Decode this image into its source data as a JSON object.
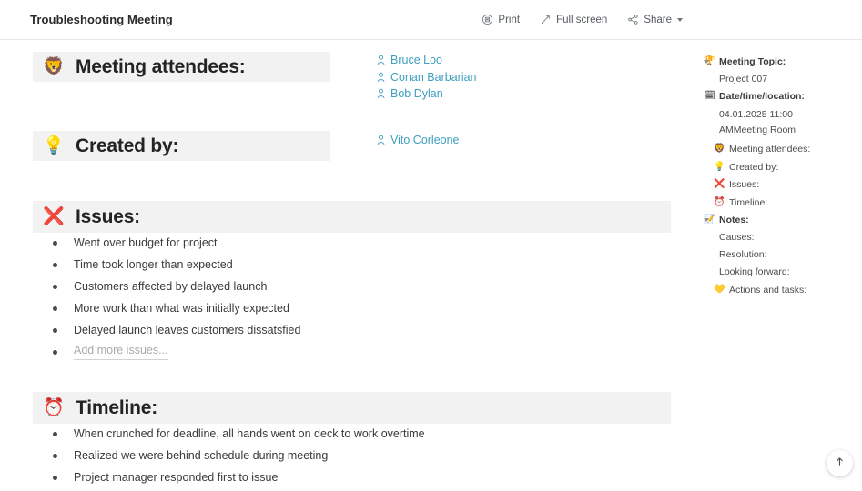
{
  "topbar": {
    "title": "Troubleshooting Meeting",
    "actions": [
      {
        "label": "Print",
        "icon": "print-icon"
      },
      {
        "label": "Full screen",
        "icon": "fullscreen-icon"
      },
      {
        "label": "Share",
        "icon": "share-icon",
        "caret": true
      }
    ]
  },
  "document": {
    "sections": [
      {
        "key": "attendees",
        "emoji": "🦁",
        "icon_name": "lion-face-emoji",
        "title": "Meeting attendees:",
        "people": [
          "Bruce Loo",
          "Conan Barbarian",
          "Bob Dylan"
        ]
      },
      {
        "key": "created_by",
        "emoji": "💡",
        "icon_name": "light-bulb-emoji",
        "title": "Created by:",
        "people": [
          "Vito Corleone"
        ]
      },
      {
        "key": "issues",
        "emoji": "❌",
        "icon_name": "cross-mark-emoji",
        "title": "Issues:",
        "items": [
          "Went over budget for project",
          "Time took longer than expected",
          "Customers affected by delayed launch",
          "More work than what was initially expected",
          "Delayed launch leaves customers dissatsfied"
        ],
        "placeholder": "Add more issues..."
      },
      {
        "key": "timeline",
        "emoji": "⏰",
        "icon_name": "alarm-clock-emoji",
        "title": "Timeline:",
        "items": [
          "When crunched for deadline, all hands went on deck to work overtime",
          "Realized we were behind schedule during meeting",
          "Project manager responded first to issue"
        ]
      }
    ]
  },
  "outline": {
    "rows": [
      {
        "label": "Meeting Topic:",
        "emoji": "🏆",
        "icon_name": "trophy-emoji",
        "twisty": true,
        "level": 0,
        "bold": true
      },
      {
        "label": "Project 007",
        "level": 1,
        "value": true
      },
      {
        "label": "Date/time/location:",
        "emoji": "🗓",
        "icon_name": "calendar-emoji",
        "twisty": true,
        "level": 0,
        "bold": true
      },
      {
        "label": "04.01.2025 11:00\nAMMeeting Room",
        "level": 1,
        "value": true,
        "multiline": true
      },
      {
        "label": "Meeting attendees:",
        "emoji": "🦁",
        "icon_name": "lion-face-emoji",
        "level": 0,
        "bold": true,
        "indent": true
      },
      {
        "label": "Created by:",
        "emoji": "💡",
        "icon_name": "light-bulb-emoji",
        "level": 0,
        "bold": true,
        "indent": true
      },
      {
        "label": "Issues:",
        "emoji": "❌",
        "icon_name": "cross-mark-emoji",
        "level": 0,
        "bold": true,
        "indent": true
      },
      {
        "label": "Timeline:",
        "emoji": "⏰",
        "icon_name": "alarm-clock-emoji",
        "level": 0,
        "bold": true,
        "indent": true
      },
      {
        "label": "Notes:",
        "emoji": "📝",
        "icon_name": "memo-emoji",
        "twisty": true,
        "level": 0,
        "bold": true
      },
      {
        "label": "Causes:",
        "level": 1,
        "value": true
      },
      {
        "label": "Resolution:",
        "level": 1,
        "value": true
      },
      {
        "label": "Looking forward:",
        "level": 1,
        "value": true
      },
      {
        "label": "Actions and tasks:",
        "emoji": "💛",
        "icon_name": "yellow-heart-emoji",
        "level": 0,
        "bold": true,
        "indent": true
      }
    ]
  },
  "scroll_top": {
    "icon_name": "arrow-up-icon"
  },
  "colors": {
    "link": "#3f9fc0",
    "section_header_bg": "#f2f2f2",
    "text": "#333333"
  }
}
